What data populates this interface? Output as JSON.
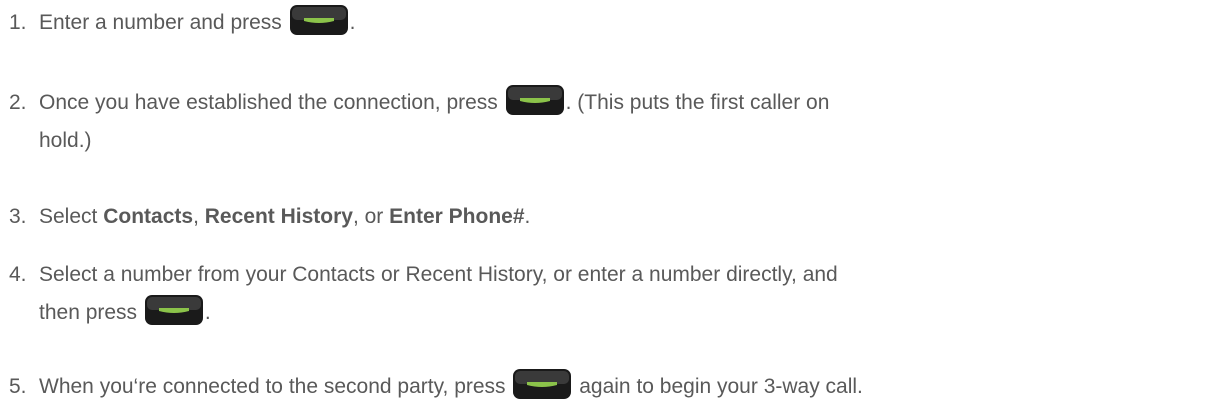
{
  "steps": [
    {
      "number": "1.",
      "text_before": "Enter a number and press ",
      "text_after": "."
    },
    {
      "number": "2.",
      "text_before": "Once you have established the connection, press ",
      "text_after": ". (This puts the first caller on",
      "text_line2": "hold.)"
    },
    {
      "number": "3.",
      "text_before": "Select ",
      "bold1": "Contacts",
      "sep1": ", ",
      "bold2": "Recent History",
      "sep2": ", or ",
      "bold3": "Enter Phone#",
      "text_after": "."
    },
    {
      "number": "4.",
      "text_line1": "Select a number from your Contacts or Recent History, or enter a number directly, and",
      "text_before": "then press ",
      "text_after": "."
    },
    {
      "number": "5.",
      "text_before": "When you‘re connected to the second party, press ",
      "text_after": " again to begin your 3-way call."
    }
  ],
  "icons": {
    "talk_key": "talk-key-icon",
    "key_body_color": "#1a1a1a",
    "key_glyph_color": "#8bc34a"
  }
}
